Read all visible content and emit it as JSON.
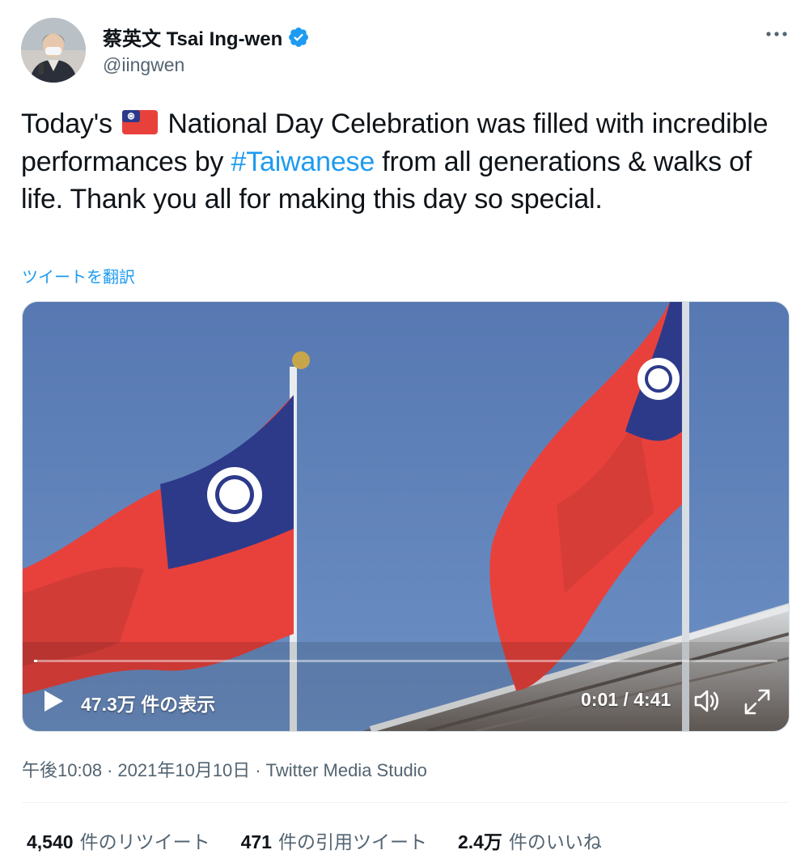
{
  "tweet": {
    "author": {
      "display_name": "蔡英文 Tsai Ing-wen",
      "handle": "@iingwen",
      "verified_icon": "verified-badge-icon",
      "avatar": "profile-photo"
    },
    "more_icon": "more-horizontal-icon",
    "text": {
      "part1": "Today's ",
      "emoji": "taiwan-flag-emoji",
      "part2": " National Day Celebration was filled with incredible performances by ",
      "hashtag": "#Taiwanese",
      "part3": " from all generations & walks of life. Thank you all for making this day so special."
    },
    "translate_label": "ツイートを翻訳",
    "video": {
      "views": "47.3万 件の表示",
      "time": "0:01 / 4:41",
      "progress_fraction": 0.004,
      "play_icon": "play-icon",
      "volume_icon": "volume-icon",
      "fullscreen_icon": "fullscreen-icon"
    },
    "meta": {
      "time": "午後10:08",
      "date": "2021年10月10日",
      "separator": "·",
      "source": "Twitter Media Studio"
    },
    "stats": [
      {
        "value": "4,540",
        "label": "件のリツイート"
      },
      {
        "value": "471",
        "label": "件の引用ツイート"
      },
      {
        "value": "2.4万",
        "label": "件のいいね"
      }
    ]
  },
  "colors": {
    "link": "#1d9bf0",
    "text": "#0f1419",
    "secondary": "#536471",
    "sky": "#5d82b9",
    "flag_red": "#e8413c",
    "flag_blue": "#2d3a8a"
  }
}
